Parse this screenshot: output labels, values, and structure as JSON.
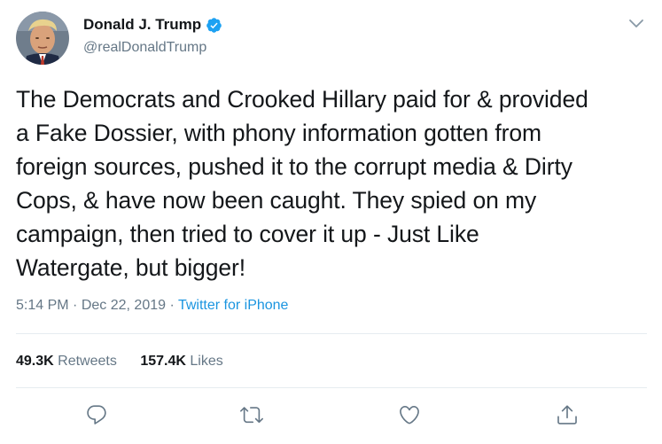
{
  "author": {
    "display_name": "Donald J. Trump",
    "handle": "@realDonaldTrump",
    "verified": true,
    "avatar_icon": "avatar-photo"
  },
  "tweet": {
    "text": "The Democrats and Crooked Hillary paid for & provided\na Fake Dossier, with phony information gotten from\nforeign sources, pushed it to the corrupt media & Dirty\nCops, & have now been caught. They spied on my\ncampaign, then tried to cover it up - Just Like\nWatergate, but bigger!",
    "time": "5:14 PM",
    "date": "Dec 22, 2019",
    "source": "Twitter for iPhone",
    "separator": "·"
  },
  "stats": {
    "retweets_count": "49.3K",
    "retweets_label": "Retweets",
    "likes_count": "157.4K",
    "likes_label": "Likes"
  },
  "actions": [
    "reply-icon",
    "retweet-icon",
    "like-icon",
    "share-icon"
  ],
  "colors": {
    "text": "#14171a",
    "secondary": "#657786",
    "link": "#1b95e0",
    "verified": "#1da1f2",
    "divider": "#e6ecf0"
  }
}
